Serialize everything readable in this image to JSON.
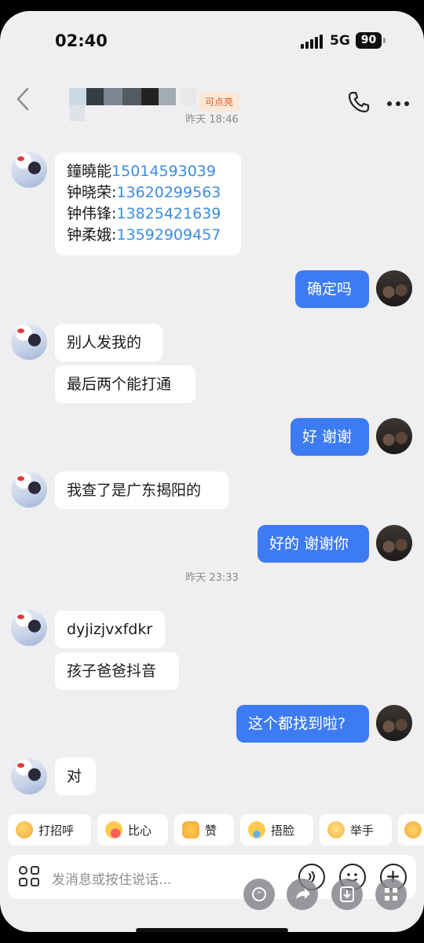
{
  "status_bar": {
    "time": "02:40",
    "network": "5G",
    "battery": "90"
  },
  "header": {
    "follow_tag": "可点亮"
  },
  "timestamps": [
    "昨天 18:46",
    "昨天 23:33"
  ],
  "contacts_message": [
    {
      "name": "鐘曉能",
      "phone": "15014593039"
    },
    {
      "name": "钟晓荣:",
      "phone": "13620299563"
    },
    {
      "name": "钟伟锋:",
      "phone": "13825421639"
    },
    {
      "name": "钟柔娥:",
      "phone": "13592909457"
    }
  ],
  "messages": [
    {
      "side": "out",
      "text": "确定吗"
    },
    {
      "side": "in",
      "text": "别人发我的"
    },
    {
      "side": "in",
      "text": "最后两个能打通"
    },
    {
      "side": "out",
      "text": "好 谢谢"
    },
    {
      "side": "in",
      "text": "我查了是广东揭阳的"
    },
    {
      "side": "out",
      "text": "好的 谢谢你"
    },
    {
      "side": "in",
      "text": "dyjizjvxfdkr"
    },
    {
      "side": "in",
      "text": "孩子爸爸抖音"
    },
    {
      "side": "out",
      "text": "这个都找到啦?"
    },
    {
      "side": "in",
      "text": "对"
    }
  ],
  "quick_replies": [
    {
      "label": "打招呼",
      "icon": "wave-emoji-icon"
    },
    {
      "label": "比心",
      "icon": "finger-heart-emoji-icon"
    },
    {
      "label": "赞",
      "icon": "thumbs-up-emoji-icon"
    },
    {
      "label": "捂脸",
      "icon": "facepalm-emoji-icon"
    },
    {
      "label": "举手",
      "icon": "raise-hand-emoji-icon"
    }
  ],
  "input": {
    "placeholder": "发消息或按住说话..."
  },
  "colors": {
    "outgoing_bubble": "#3d7bf2",
    "phone_link": "#3b8ce0",
    "follow_tag_text": "#e2582b",
    "background": "#efeff1"
  }
}
